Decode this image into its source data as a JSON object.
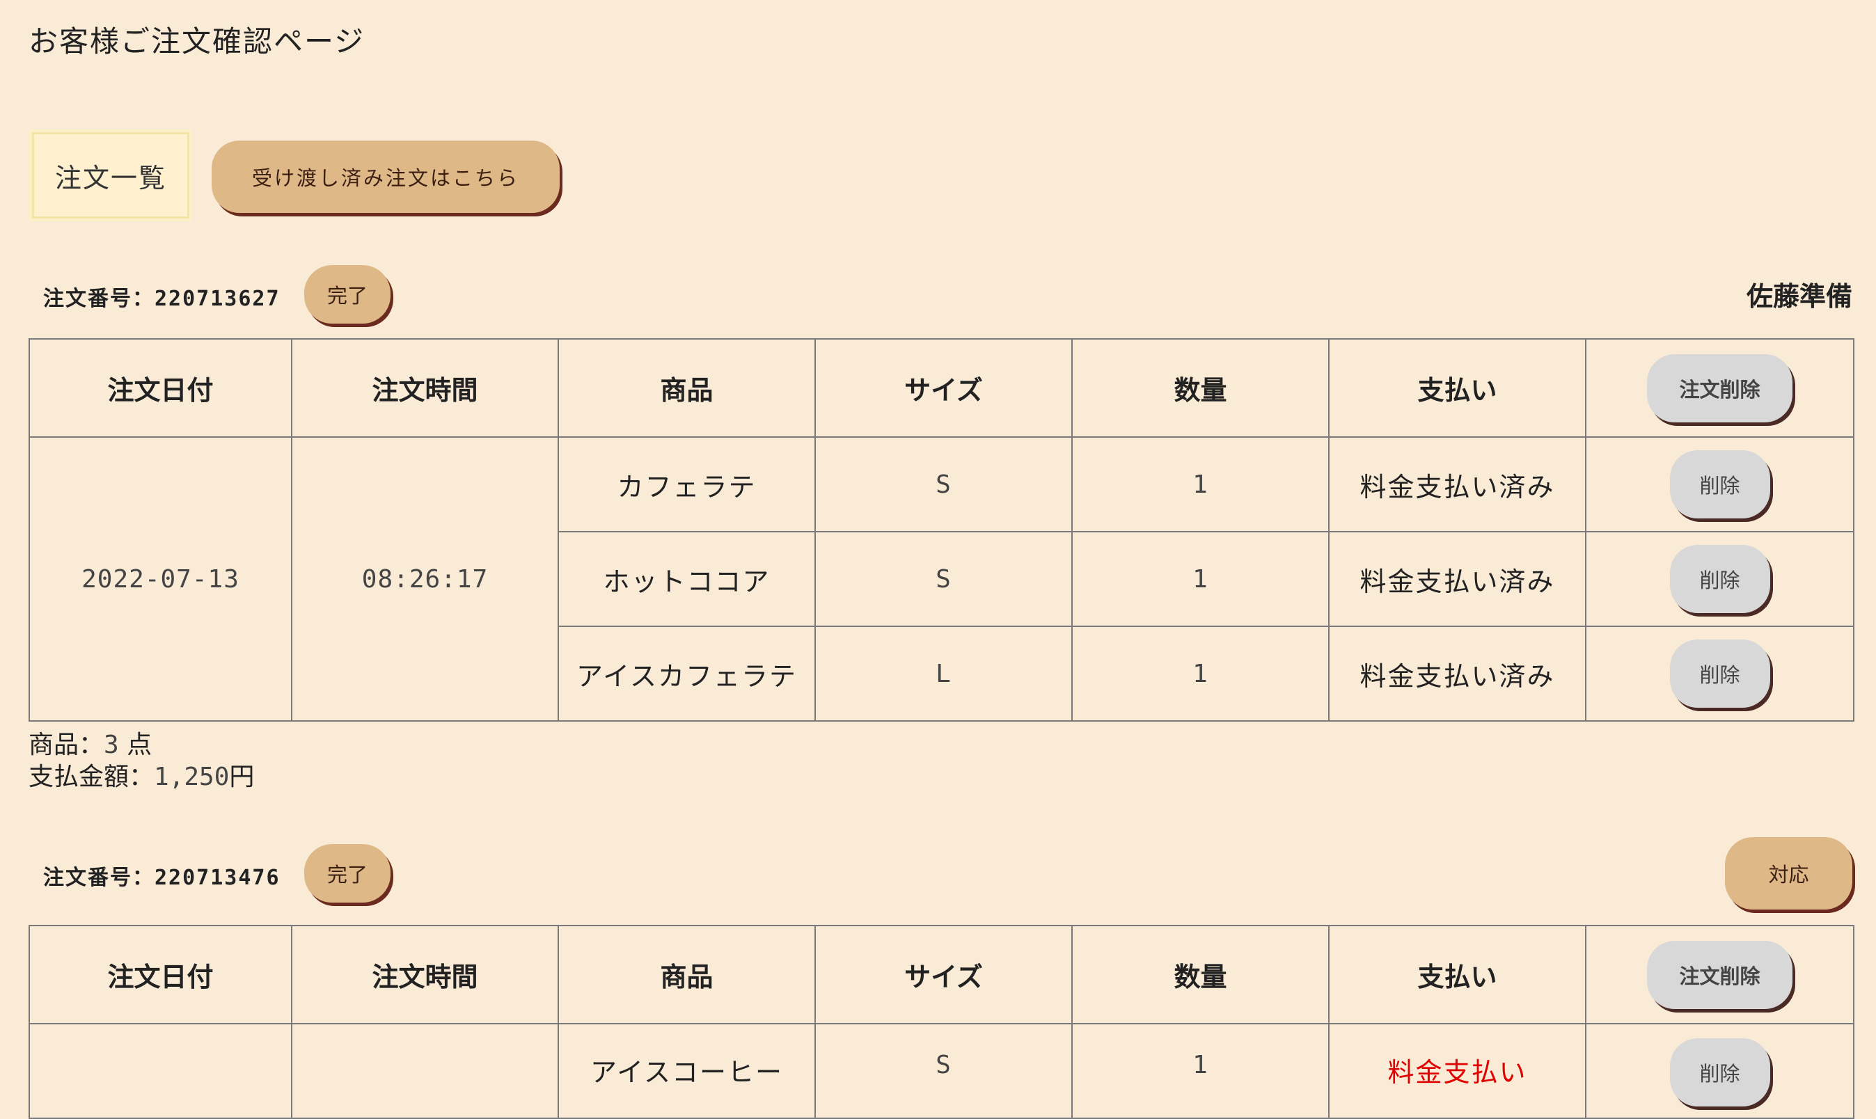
{
  "page": {
    "title": "お客様ご注文確認ページ"
  },
  "tabs": {
    "active": "注文一覧",
    "link": "受け渡し済み注文はこちら"
  },
  "headers": [
    "注文日付",
    "注文時間",
    "商品",
    "サイズ",
    "数量",
    "支払い"
  ],
  "delete_order_label": "注文削除",
  "delete_label": "削除",
  "orders": [
    {
      "order_label": "注文番号：",
      "order_number": "220713627",
      "complete_label": "完了",
      "staff": "佐藤準備",
      "date": "2022-07-13",
      "time": "08:26:17",
      "items": [
        {
          "name": "カフェラテ",
          "size": "S",
          "qty": "1",
          "payment": "料金支払い済み"
        },
        {
          "name": "ホットココア",
          "size": "S",
          "qty": "1",
          "payment": "料金支払い済み"
        },
        {
          "name": "アイスカフェラテ",
          "size": "L",
          "qty": "1",
          "payment": "料金支払い済み"
        }
      ],
      "summary": {
        "items_label": "商品：",
        "items_count": "3",
        "items_unit": " 点",
        "total_label": "支払金額：",
        "total_value": "1,250",
        "total_unit": "円"
      }
    },
    {
      "order_label": "注文番号：",
      "order_number": "220713476",
      "complete_label": "完了",
      "respond_label": "対応",
      "items": [
        {
          "name": "アイスコーヒー",
          "size": "S",
          "qty": "1",
          "payment": "料金支払い"
        }
      ]
    }
  ]
}
